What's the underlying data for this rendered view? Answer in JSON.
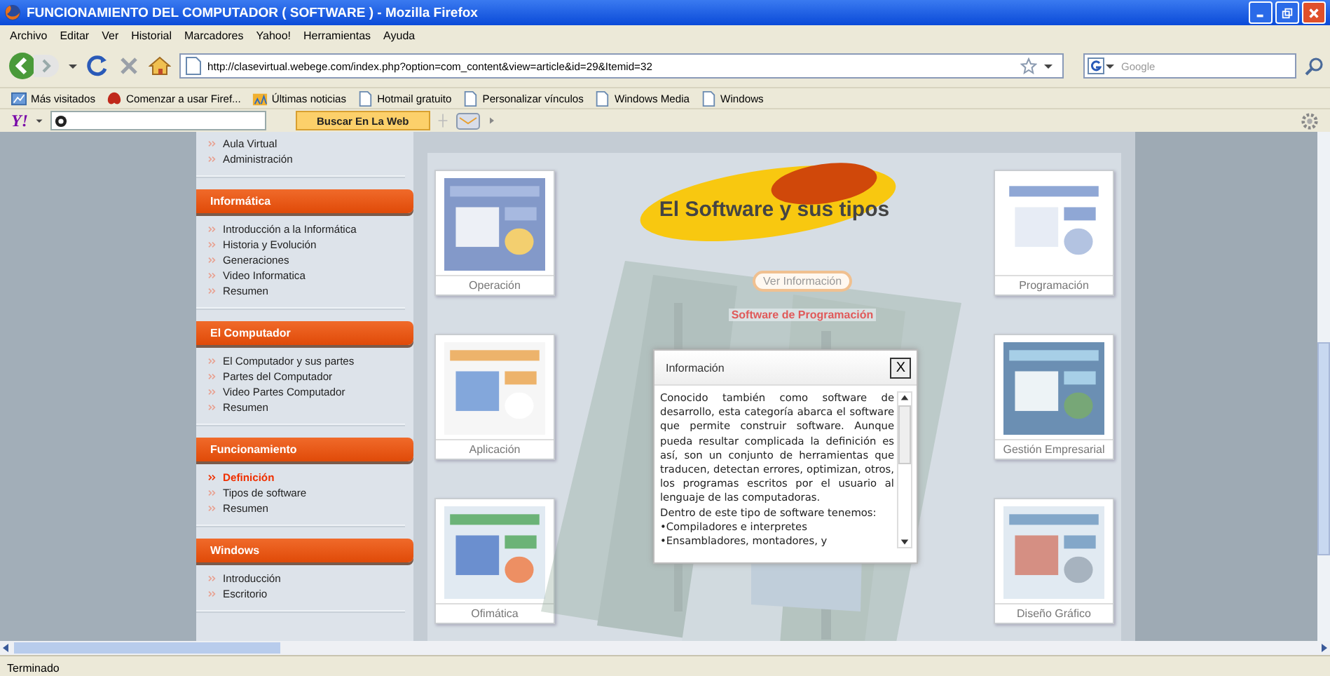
{
  "window": {
    "title": "FUNCIONAMIENTO DEL COMPUTADOR ( SOFTWARE ) - Mozilla Firefox"
  },
  "menu": [
    "Archivo",
    "Editar",
    "Ver",
    "Historial",
    "Marcadores",
    "Yahoo!",
    "Herramientas",
    "Ayuda"
  ],
  "navigation": {
    "url": "http://clasevirtual.webege.com/index.php?option=com_content&view=article&id=29&Itemid=32",
    "search_placeholder": "Google"
  },
  "bookmarks": [
    "Más visitados",
    "Comenzar a usar Firef...",
    "Últimas noticias",
    "Hotmail gratuito",
    "Personalizar vínculos",
    "Windows Media",
    "Windows"
  ],
  "yahoo_toolbar": {
    "logo": "Y!",
    "search_button": "Buscar En La Web"
  },
  "sidebar": {
    "sections": [
      {
        "items": [
          {
            "label": "Aula Virtual",
            "selected": false
          },
          {
            "label": "Administración",
            "selected": false
          }
        ]
      },
      {
        "title": "Informática",
        "items": [
          {
            "label": "Introducción a la Informática",
            "selected": false
          },
          {
            "label": "Historia y Evolución",
            "selected": false
          },
          {
            "label": "Generaciones",
            "selected": false
          },
          {
            "label": "Video Informatica",
            "selected": false
          },
          {
            "label": "Resumen",
            "selected": false
          }
        ]
      },
      {
        "title": "El Computador",
        "items": [
          {
            "label": "El Computador y sus partes",
            "selected": false
          },
          {
            "label": "Partes del Computador",
            "selected": false
          },
          {
            "label": "Video Partes Computador",
            "selected": false
          },
          {
            "label": "Resumen",
            "selected": false
          }
        ]
      },
      {
        "title": "Funcionamiento",
        "items": [
          {
            "label": "Definición",
            "selected": true
          },
          {
            "label": "Tipos de software",
            "selected": false
          },
          {
            "label": "Resumen",
            "selected": false
          }
        ]
      },
      {
        "title": "Windows",
        "items": [
          {
            "label": "Introducción",
            "selected": false
          },
          {
            "label": "Escritorio",
            "selected": false
          }
        ]
      }
    ]
  },
  "content": {
    "title": "El Software y sus tipos",
    "button": "Ver Información",
    "subtitle": "Software de Programación",
    "left_cards": [
      "Operación",
      "Aplicación",
      "Ofimática"
    ],
    "right_cards": [
      "Programación",
      "Gestión Empresarial",
      "Diseño Gráfico"
    ]
  },
  "dialog": {
    "title": "Información",
    "close": "X",
    "paragraphs": [
      "Conocido también como software de desarrollo, esta categoría abarca el software que permite construir software. Aunque pueda resultar complicada la definición es así, son un conjunto de herramientas que traducen, detectan errores, optimizan, otros, los programas escritos por el usuario al lenguaje de las computadoras.",
      "Dentro de este tipo de software tenemos:",
      "•Compiladores e interpretes",
      "•Ensambladores, montadores, y"
    ]
  },
  "status_bar": {
    "text": "Terminado"
  }
}
